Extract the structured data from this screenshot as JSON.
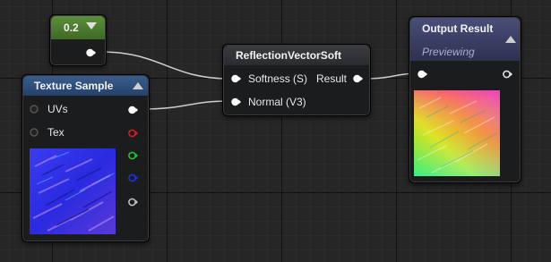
{
  "constant_node": {
    "value": "0.2"
  },
  "texture_sample": {
    "title": "Texture Sample",
    "inputs": [
      "UVs",
      "Tex"
    ],
    "preview_icon": "normal-map-preview"
  },
  "reflection_node": {
    "title": "ReflectionVectorSoft",
    "inputs": [
      "Softness (S)",
      "Normal (V3)"
    ],
    "output": "Result"
  },
  "output_node": {
    "title": "Output Result",
    "status": "Previewing",
    "preview_icon": "reflection-preview"
  },
  "colors": {
    "constant_header": "#4b7a2f",
    "texture_header": "#2e4a72",
    "output_header": "#3b3e63",
    "pin_white": "#ffffff",
    "pin_red": "#d02020",
    "pin_green": "#20c030",
    "pin_blue": "#2030e0",
    "pin_gray": "#bdbdbd"
  }
}
